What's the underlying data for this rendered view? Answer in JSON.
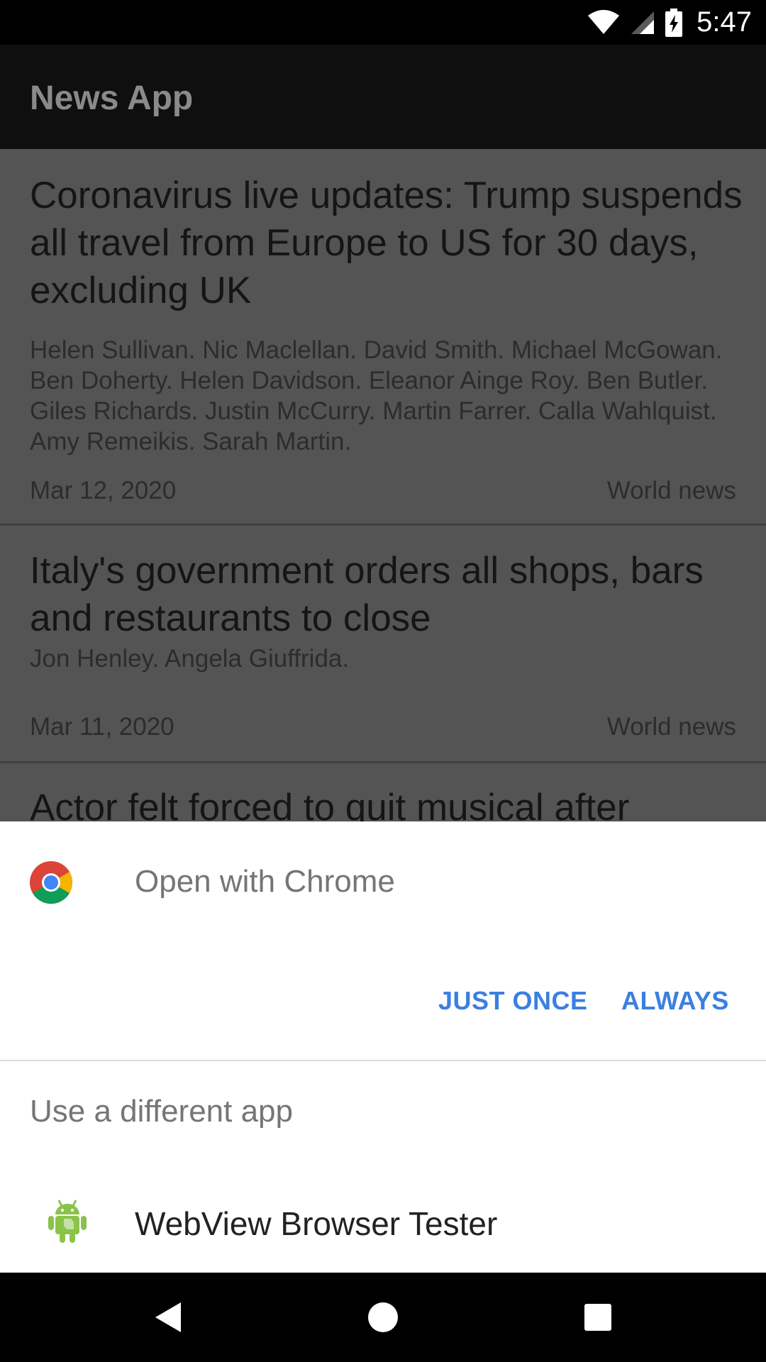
{
  "status_bar": {
    "time": "5:47",
    "icons": [
      "wifi-icon",
      "signal-icon",
      "battery-charging-icon"
    ]
  },
  "app_bar": {
    "title": "News App"
  },
  "articles": [
    {
      "title": "Coronavirus live updates: Trump suspends all travel from Europe to US for 30 days, excluding UK",
      "authors": "Helen Sullivan. Nic Maclellan. David Smith. Michael McGowan. Ben Doherty. Helen Davidson. Eleanor Ainge Roy. Ben Butler. Giles Richards. Justin McCurry. Martin Farrer. Calla Wahlquist. Amy Remeikis. Sarah Martin.",
      "date": "Mar 12, 2020",
      "section": "World news"
    },
    {
      "title": "Italy's government orders all shops, bars and restaurants to close",
      "authors": "Jon Henley. Angela Giuffrida.",
      "date": "Mar 11, 2020",
      "section": "World news"
    },
    {
      "title": "Actor felt forced to quit musical after"
    }
  ],
  "chooser": {
    "primary_app": "Open with Chrome",
    "just_once": "JUST ONCE",
    "always": "ALWAYS",
    "different_app": "Use a different app",
    "other_app": "WebView Browser Tester"
  },
  "colors": {
    "accent": "#3b7fe0",
    "scrim_list": "#545454"
  },
  "nav_bar": {
    "buttons": [
      "back-icon",
      "home-icon",
      "recents-icon"
    ]
  }
}
